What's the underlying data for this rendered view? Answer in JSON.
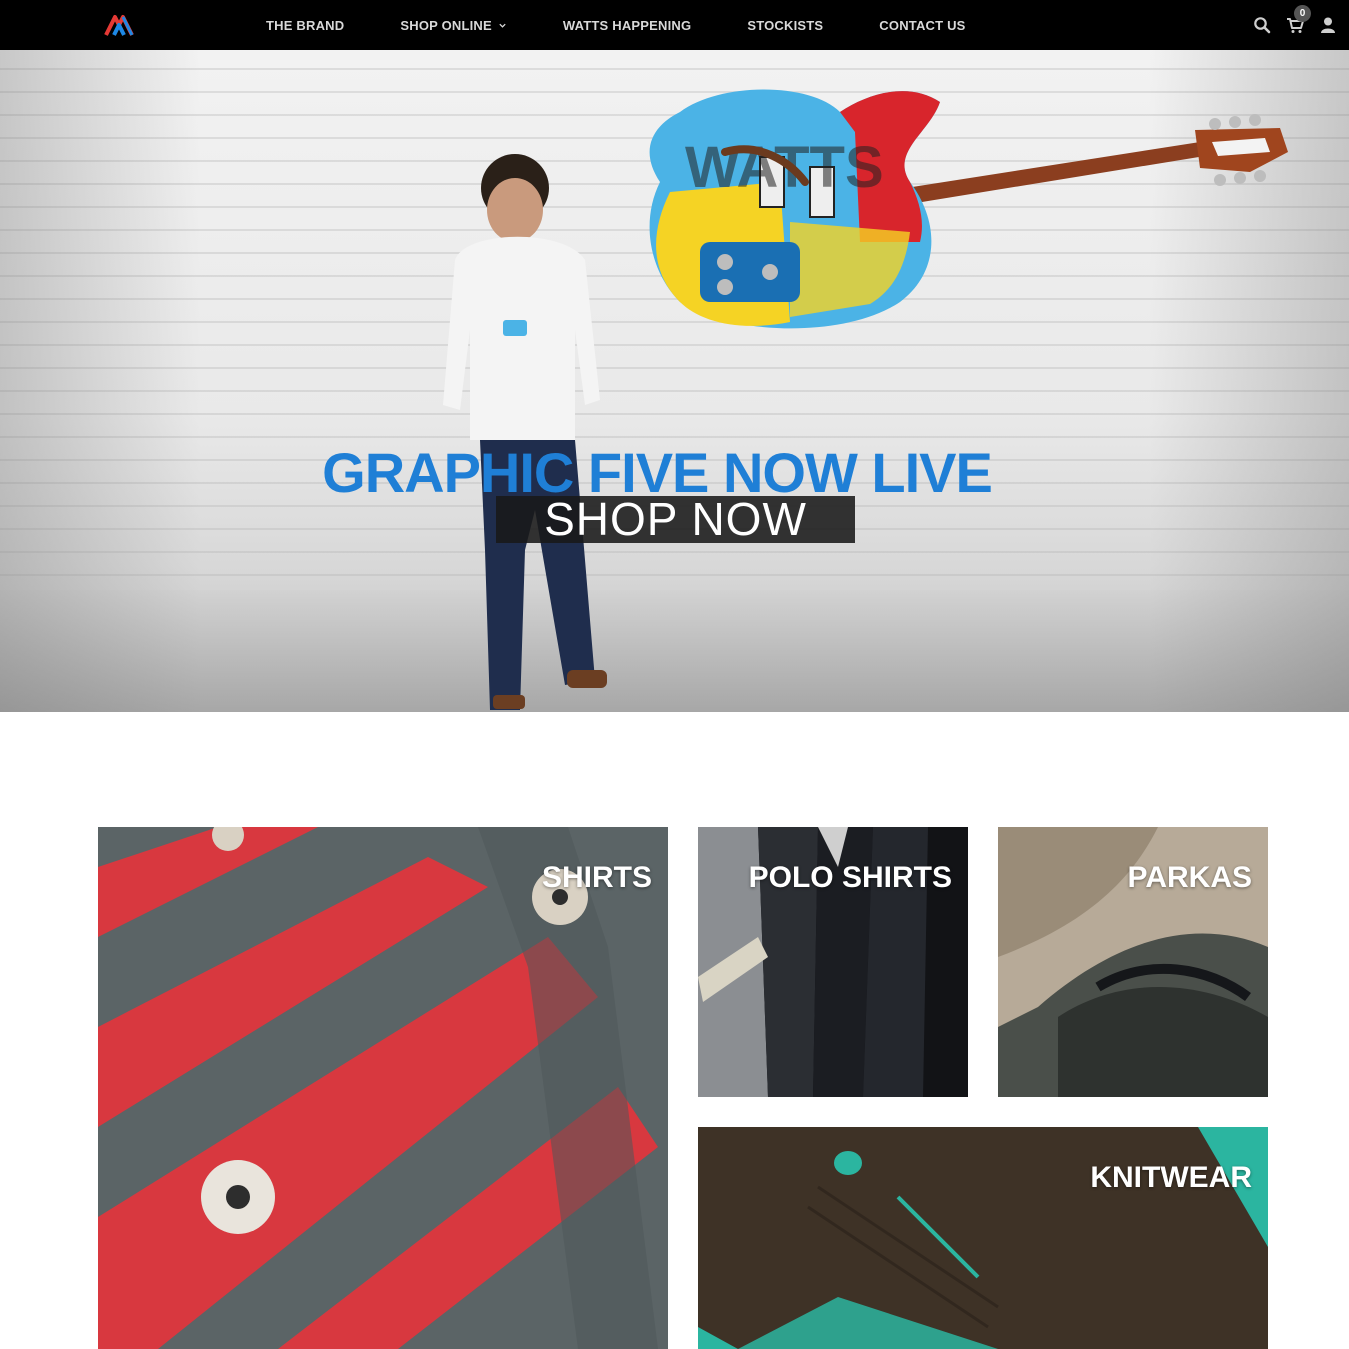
{
  "nav": {
    "menu": [
      {
        "label": "THE BRAND"
      },
      {
        "label": "SHOP ONLINE"
      },
      {
        "label": "WATTS HAPPENING"
      },
      {
        "label": "STOCKISTS"
      },
      {
        "label": "CONTACT US"
      }
    ],
    "cart_count": "0",
    "icons": [
      "brand-logo",
      "chevron-down-icon",
      "search-icon",
      "cart-icon",
      "user-icon"
    ]
  },
  "hero": {
    "headline": "GRAPHIC FIVE NOW LIVE",
    "cta": "SHOP NOW"
  },
  "categories": [
    {
      "label": "SHIRTS"
    },
    {
      "label": "POLO SHIRTS"
    },
    {
      "label": "PARKAS"
    },
    {
      "label": "KNITWEAR"
    }
  ],
  "colors": {
    "nav_bg": "#000000",
    "headline": "#1f7fd6",
    "cta_bg": "#191919",
    "shirt_red": "#d8383f",
    "shirt_grey": "#5b6466",
    "knit_brown": "#3e3226",
    "knit_teal": "#2bb5a0"
  }
}
